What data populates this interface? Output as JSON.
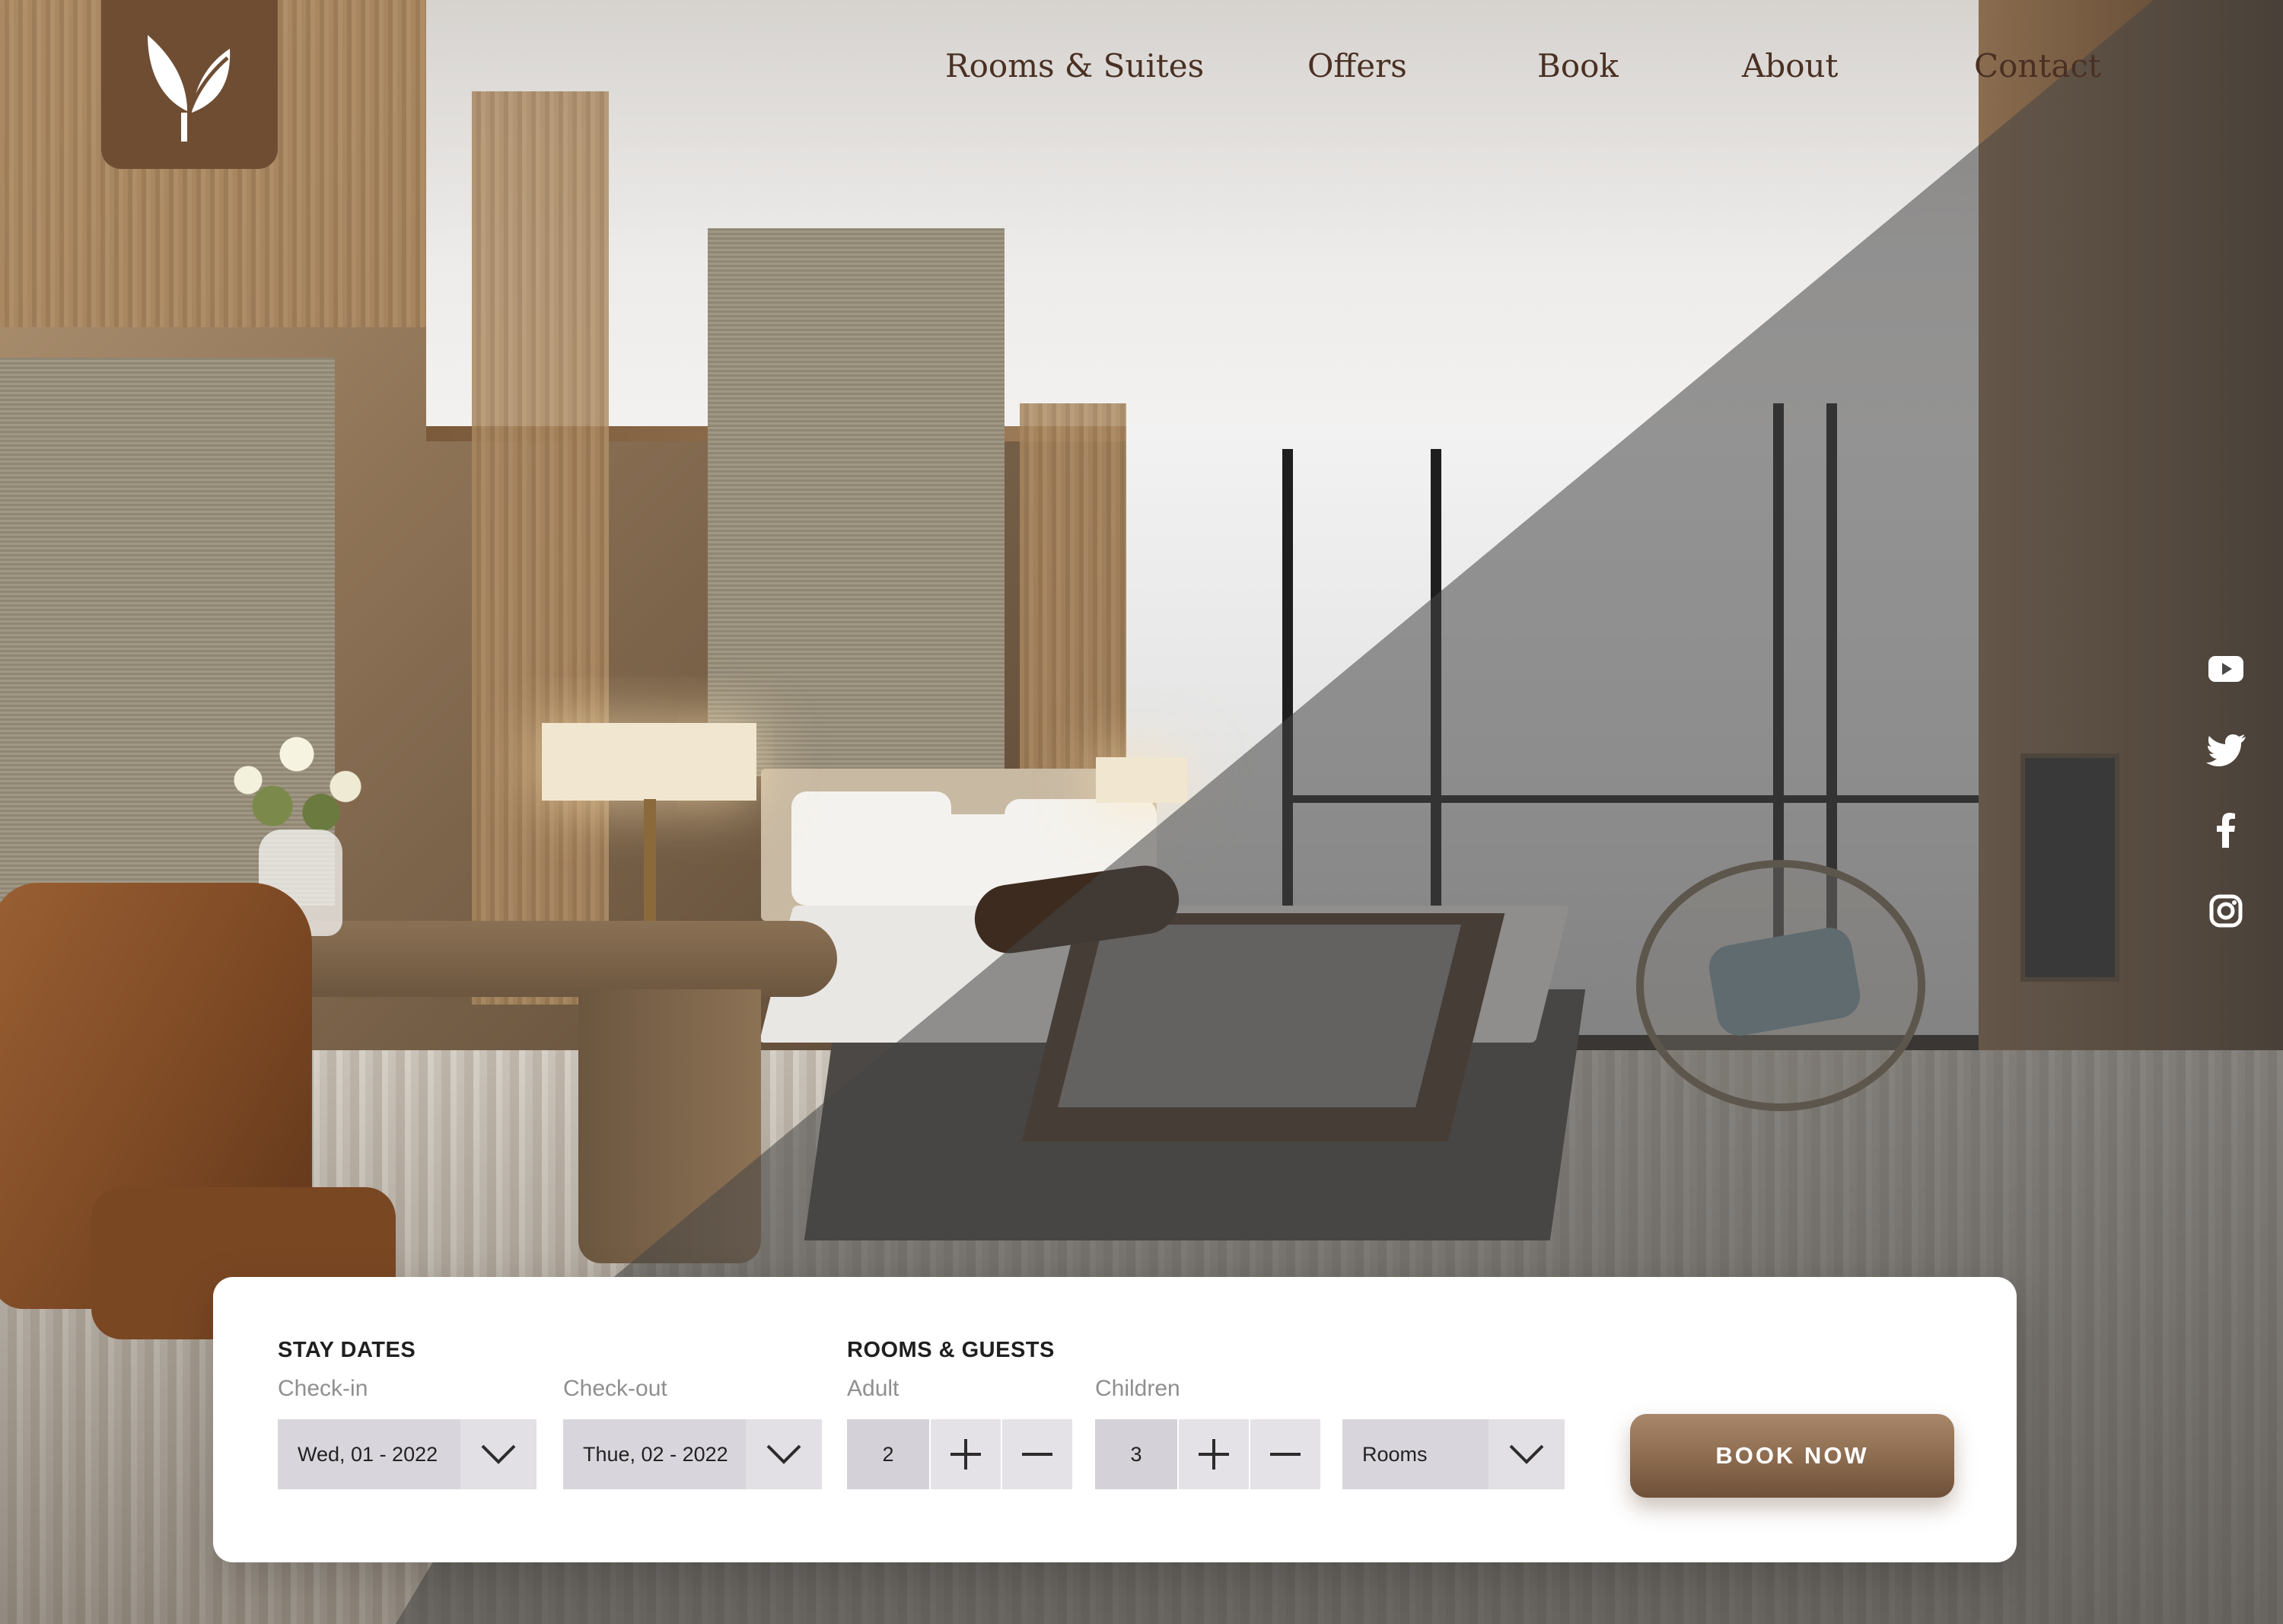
{
  "nav": {
    "items": [
      {
        "label": "Rooms & Suites"
      },
      {
        "label": "Offers"
      },
      {
        "label": "Book"
      },
      {
        "label": "About"
      },
      {
        "label": "Contact"
      }
    ]
  },
  "logo": {
    "icon": "leaf-logo-icon"
  },
  "social": {
    "icons": [
      "youtube-icon",
      "twitter-icon",
      "facebook-icon",
      "instagram-icon"
    ]
  },
  "booking": {
    "stay_dates": {
      "title": "STAY DATES",
      "checkin_label": "Check-in",
      "checkin_value": "Wed, 01 - 2022",
      "checkout_label": "Check-out",
      "checkout_value": "Thue, 02 - 2022"
    },
    "rooms_guests": {
      "title": "ROOMS & GUESTS",
      "adult_label": "Adult",
      "adult_value": "2",
      "children_label": "Children",
      "children_value": "3",
      "rooms_value": "Rooms"
    },
    "book_button": "BOOK NOW"
  },
  "colors": {
    "brand_brown": "#6f4d33",
    "nav_text": "#4a3023",
    "button_top": "#a8876a",
    "button_bottom": "#6e5039",
    "field_bg": "#d8d6dc"
  }
}
